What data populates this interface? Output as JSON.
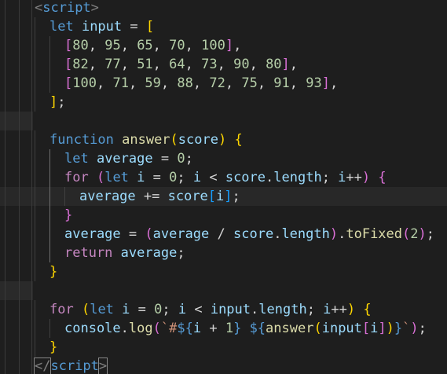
{
  "editor": {
    "lines": [
      [
        [
          "t-tag",
          "<"
        ],
        [
          "t-tagname",
          "script"
        ],
        [
          "t-tag",
          ">"
        ]
      ],
      [
        [
          "t-kw",
          "let "
        ],
        [
          "t-var",
          "input"
        ],
        [
          "t-op",
          " = "
        ],
        [
          "t-b1",
          "["
        ]
      ],
      [
        [
          "t-b2",
          "["
        ],
        [
          "t-num",
          "80"
        ],
        [
          "t-op",
          ", "
        ],
        [
          "t-num",
          "95"
        ],
        [
          "t-op",
          ", "
        ],
        [
          "t-num",
          "65"
        ],
        [
          "t-op",
          ", "
        ],
        [
          "t-num",
          "70"
        ],
        [
          "t-op",
          ", "
        ],
        [
          "t-num",
          "100"
        ],
        [
          "t-b2",
          "]"
        ],
        [
          "t-op",
          ","
        ]
      ],
      [
        [
          "t-b2",
          "["
        ],
        [
          "t-num",
          "82"
        ],
        [
          "t-op",
          ", "
        ],
        [
          "t-num",
          "77"
        ],
        [
          "t-op",
          ", "
        ],
        [
          "t-num",
          "51"
        ],
        [
          "t-op",
          ", "
        ],
        [
          "t-num",
          "64"
        ],
        [
          "t-op",
          ", "
        ],
        [
          "t-num",
          "73"
        ],
        [
          "t-op",
          ", "
        ],
        [
          "t-num",
          "90"
        ],
        [
          "t-op",
          ", "
        ],
        [
          "t-num",
          "80"
        ],
        [
          "t-b2",
          "]"
        ],
        [
          "t-op",
          ","
        ]
      ],
      [
        [
          "t-b2",
          "["
        ],
        [
          "t-num",
          "100"
        ],
        [
          "t-op",
          ", "
        ],
        [
          "t-num",
          "71"
        ],
        [
          "t-op",
          ", "
        ],
        [
          "t-num",
          "59"
        ],
        [
          "t-op",
          ", "
        ],
        [
          "t-num",
          "88"
        ],
        [
          "t-op",
          ", "
        ],
        [
          "t-num",
          "72"
        ],
        [
          "t-op",
          ", "
        ],
        [
          "t-num",
          "75"
        ],
        [
          "t-op",
          ", "
        ],
        [
          "t-num",
          "91"
        ],
        [
          "t-op",
          ", "
        ],
        [
          "t-num",
          "93"
        ],
        [
          "t-b2",
          "]"
        ],
        [
          "t-op",
          ","
        ]
      ],
      [
        [
          "t-b1",
          "]"
        ],
        [
          "t-op",
          ";"
        ]
      ],
      [],
      [
        [
          "t-kw",
          "function "
        ],
        [
          "t-fn",
          "answer"
        ],
        [
          "t-b1",
          "("
        ],
        [
          "t-var",
          "score"
        ],
        [
          "t-b1",
          ")"
        ],
        [
          "t-op",
          " "
        ],
        [
          "t-b1",
          "{"
        ]
      ],
      [
        [
          "t-kw",
          "let "
        ],
        [
          "t-var",
          "average"
        ],
        [
          "t-op",
          " = "
        ],
        [
          "t-num",
          "0"
        ],
        [
          "t-op",
          ";"
        ]
      ],
      [
        [
          "t-ctrl",
          "for "
        ],
        [
          "t-b2",
          "("
        ],
        [
          "t-kw",
          "let "
        ],
        [
          "t-var",
          "i"
        ],
        [
          "t-op",
          " = "
        ],
        [
          "t-num",
          "0"
        ],
        [
          "t-op",
          "; "
        ],
        [
          "t-var",
          "i"
        ],
        [
          "t-op",
          " < "
        ],
        [
          "t-var",
          "score"
        ],
        [
          "t-op",
          "."
        ],
        [
          "t-var",
          "length"
        ],
        [
          "t-op",
          "; "
        ],
        [
          "t-var",
          "i"
        ],
        [
          "t-op",
          "++"
        ],
        [
          "t-b2",
          ")"
        ],
        [
          "t-op",
          " "
        ],
        [
          "t-b2",
          "{"
        ]
      ],
      [
        [
          "t-var",
          "average"
        ],
        [
          "t-op",
          " += "
        ],
        [
          "t-var",
          "score"
        ],
        [
          "t-b3",
          "["
        ],
        [
          "t-var",
          "i"
        ],
        [
          "t-b3",
          "]"
        ],
        [
          "t-op",
          ";"
        ]
      ],
      [
        [
          "t-b2",
          "}"
        ]
      ],
      [
        [
          "t-var",
          "average"
        ],
        [
          "t-op",
          " = "
        ],
        [
          "t-b2",
          "("
        ],
        [
          "t-var",
          "average"
        ],
        [
          "t-op",
          " / "
        ],
        [
          "t-var",
          "score"
        ],
        [
          "t-op",
          "."
        ],
        [
          "t-var",
          "length"
        ],
        [
          "t-b2",
          ")"
        ],
        [
          "t-op",
          "."
        ],
        [
          "t-fn",
          "toFixed"
        ],
        [
          "t-b2",
          "("
        ],
        [
          "t-num",
          "2"
        ],
        [
          "t-b2",
          ")"
        ],
        [
          "t-op",
          ";"
        ]
      ],
      [
        [
          "t-ctrl",
          "return "
        ],
        [
          "t-var",
          "average"
        ],
        [
          "t-op",
          ";"
        ]
      ],
      [
        [
          "t-b1",
          "}"
        ]
      ],
      [],
      [
        [
          "t-ctrl",
          "for "
        ],
        [
          "t-b1",
          "("
        ],
        [
          "t-kw",
          "let "
        ],
        [
          "t-var",
          "i"
        ],
        [
          "t-op",
          " = "
        ],
        [
          "t-num",
          "0"
        ],
        [
          "t-op",
          "; "
        ],
        [
          "t-var",
          "i"
        ],
        [
          "t-op",
          " < "
        ],
        [
          "t-var",
          "input"
        ],
        [
          "t-op",
          "."
        ],
        [
          "t-var",
          "length"
        ],
        [
          "t-op",
          "; "
        ],
        [
          "t-var",
          "i"
        ],
        [
          "t-op",
          "++"
        ],
        [
          "t-b1",
          ")"
        ],
        [
          "t-op",
          " "
        ],
        [
          "t-b1",
          "{"
        ]
      ],
      [
        [
          "t-var",
          "console"
        ],
        [
          "t-op",
          "."
        ],
        [
          "t-fn",
          "log"
        ],
        [
          "t-b2",
          "("
        ],
        [
          "t-str",
          "`#"
        ],
        [
          "t-interp",
          "${"
        ],
        [
          "t-var",
          "i"
        ],
        [
          "t-op",
          " + "
        ],
        [
          "t-num",
          "1"
        ],
        [
          "t-interp",
          "}"
        ],
        [
          "t-str",
          " "
        ],
        [
          "t-interp",
          "${"
        ],
        [
          "t-fn",
          "answer"
        ],
        [
          "t-b1",
          "("
        ],
        [
          "t-var",
          "input"
        ],
        [
          "t-b2",
          "["
        ],
        [
          "t-var",
          "i"
        ],
        [
          "t-b2",
          "]"
        ],
        [
          "t-b1",
          ")"
        ],
        [
          "t-interp",
          "}"
        ],
        [
          "t-str",
          "`"
        ],
        [
          "t-b2",
          ")"
        ],
        [
          "t-op",
          ";"
        ]
      ],
      [
        [
          "t-b1",
          "}"
        ]
      ],
      [
        [
          "t-tag",
          "</"
        ],
        [
          "t-tagname",
          "script"
        ],
        [
          "t-tag",
          ">"
        ]
      ]
    ]
  }
}
